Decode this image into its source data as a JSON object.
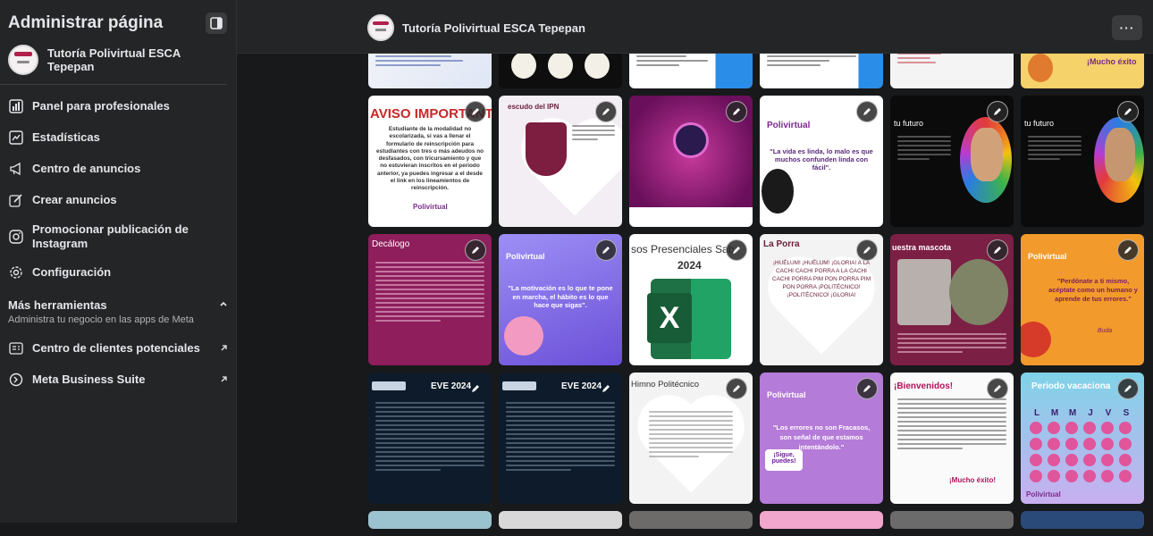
{
  "sidebar": {
    "title": "Administrar página",
    "page_name": "Tutoría Polivirtual ESCA Tepepan",
    "nav_items": [
      {
        "label": "Panel para profesionales",
        "icon": "dashboard-icon"
      },
      {
        "label": "Estadísticas",
        "icon": "insights-icon"
      },
      {
        "label": "Centro de anuncios",
        "icon": "megaphone-icon"
      },
      {
        "label": "Crear anuncios",
        "icon": "edit-square-icon"
      },
      {
        "label": "Promocionar publicación de Instagram",
        "icon": "instagram-icon"
      },
      {
        "label": "Configuración",
        "icon": "gear-icon"
      }
    ],
    "more_tools": {
      "title": "Más herramientas",
      "subtitle": "Administra tu negocio en las apps de Meta"
    },
    "tool_items": [
      {
        "label": "Centro de clientes potenciales",
        "icon": "leads-icon"
      },
      {
        "label": "Meta Business Suite",
        "icon": "meta-icon"
      }
    ]
  },
  "topbar": {
    "page_name": "Tutoría Polivirtual ESCA Tepepan",
    "more_label": "···"
  },
  "tiles": {
    "r1": [
      "AVISO IMPORTANTE",
      "Polivirtual",
      "Polivirtual",
      "tu futuro",
      "tu futuro"
    ],
    "aviso_body": "Estudiante de la modalidad no escolarizada, si vas a llenar el formulario de reinscripción para estudiantes con tres o más adeudos no desfasados, con tricursamiento y que no estuvieran inscritos en el periodo anterior, ya puedes ingresar a el desde el link en los lineamientos de reinscripción.",
    "escudo": "escudo del IPN",
    "vida": "\"La vida es linda, lo malo es que muchos confunden linda con fácil\".",
    "r2_decalogo": "Decálogo",
    "r2_motivacion": "\"La motivación es lo que te pone en marcha, el hábito es lo que hace que sigas\".",
    "r2_presenciales": "sos Presenciales Sab",
    "r2_year": "2024",
    "r2_porra": "La Porra",
    "r2_porra_body": "¡HUÉLUM! ¡HUÉLUM! ¡GLORIA! A LA CACHI CACHI PORRA A LA CACHI CACHI PORRA PIM PON PORRA PIM PON PORRA ¡POLITÉCNICO! ¡POLITÉCNICO! ¡GLORIA!",
    "r2_mascota": "uestra mascota",
    "r2_perdon": "\"Perdónate a ti mismo, acéptate como un humano y aprende de tus errores.\"",
    "r2_perdon_author": "Buda",
    "r3_eve1": "EVE 2024",
    "r3_eve2": "EVE 2024",
    "r3_himno": "Himno Politécnico",
    "r3_fracasos": "\"Los errores no son Fracasos, son señal de que estamos intentándolo.\"",
    "r3_sigue": "¡Sigue, puedes!",
    "r3_bienvenidos": "¡Bienvenidos!",
    "r3_mucho_exito": "¡Mucho éxito!",
    "r3_periodo": "Periodo vacaciona",
    "r3_days": [
      "L",
      "M",
      "M",
      "J",
      "V",
      "S"
    ],
    "mucho_exito_top": "¡Mucho éxito",
    "polivirtual": "Polivirtual"
  }
}
